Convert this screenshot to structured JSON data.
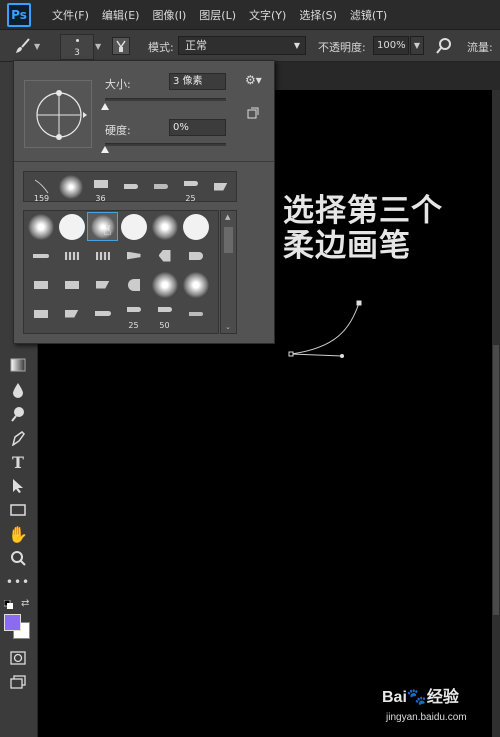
{
  "app": {
    "logo": "Ps"
  },
  "menu": {
    "items": [
      "文件(F)",
      "编辑(E)",
      "图像(I)",
      "图层(L)",
      "文字(Y)",
      "选择(S)",
      "滤镜(T)"
    ]
  },
  "options": {
    "brush_size_preview": "3",
    "mode_label": "模式:",
    "mode_value": "正常",
    "opacity_label": "不透明度:",
    "opacity_value": "100%",
    "flow_label": "流量:"
  },
  "brush_panel": {
    "size_label": "大小:",
    "size_value": "3 像素",
    "size_fraction": 0.0,
    "hardness_label": "硬度:",
    "hardness_value": "0%",
    "hardness_fraction": 0.0,
    "recent_brushes": [
      "159",
      "",
      "36",
      "",
      "",
      "25",
      ""
    ],
    "preset_row1": [
      "soft",
      "hard",
      "soft-selected",
      "hard",
      "soft",
      "hard"
    ],
    "preset_labels": [
      "25",
      "50"
    ],
    "selected_preset": "third soft round brush"
  },
  "canvas": {
    "annotation_line1": "选择第三个",
    "annotation_line2": "柔边画笔"
  },
  "colors": {
    "foreground": "#8b6cf0",
    "background": "#ffffff",
    "accent": "#47a2e0"
  },
  "watermark": {
    "brand": "Bai",
    "brand_cn": "经验",
    "url": "jingyan.baidu.com"
  }
}
